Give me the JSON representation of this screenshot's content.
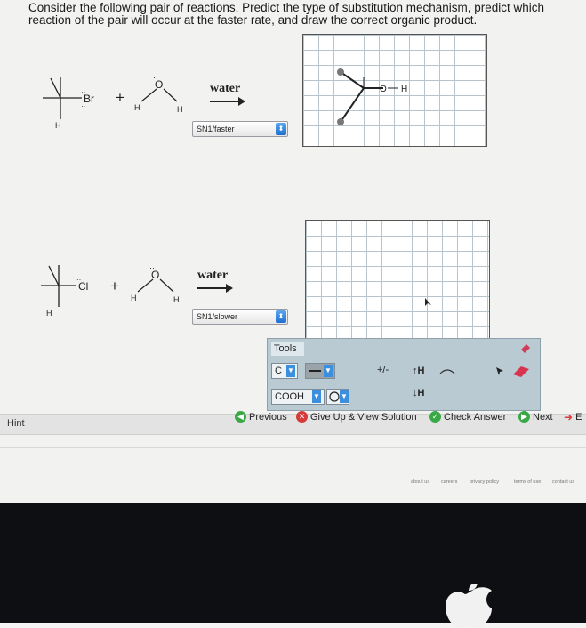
{
  "question": {
    "text": "Consider the following pair of reactions. Predict the type of substitution mechanism, predict which reaction of the pair will occur at the faster rate, and draw the correct organic product."
  },
  "reaction1": {
    "halogen": "Br",
    "h_labels": [
      "H",
      "H",
      "H"
    ],
    "plus": "+",
    "solvent": "water",
    "selection": "SN1/faster",
    "product_labels": {
      "o": "O",
      "h": "H"
    }
  },
  "reaction2": {
    "halogen": "Cl",
    "h_labels": [
      "H",
      "H",
      "H"
    ],
    "plus": "+",
    "solvent": "water",
    "selection": "SN1/slower"
  },
  "toolbar": {
    "title": "Tools",
    "carbon": "C",
    "cooh": "COOH",
    "hydrogen_up": "↑H",
    "hydrogen_down": "↓H",
    "charge": "+/-"
  },
  "nav": {
    "previous": "Previous",
    "give_up": "Give Up & View Solution",
    "check": "Check Answer",
    "next": "Next",
    "exit_partial": "E"
  },
  "hint": "Hint",
  "footer_links": [
    "about us",
    "careers",
    "privacy policy",
    "terms of use",
    "contact us"
  ],
  "colors": {
    "accent_blue": "#2a7fe0",
    "check_green": "#39a845",
    "give_up_red": "#d83a3a",
    "toolbar_bg": "#b9cad3"
  }
}
